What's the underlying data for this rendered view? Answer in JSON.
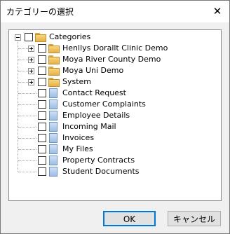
{
  "dialog": {
    "title": "カテゴリーの選択",
    "close_label": "✕"
  },
  "tree": {
    "root": {
      "label": "Categories",
      "expanded": true,
      "checked": false
    },
    "groups": [
      {
        "label": "Henllys Dorallt Clinic Demo",
        "expanded": false,
        "checked": false
      },
      {
        "label": "Moya River County Demo",
        "expanded": false,
        "checked": false
      },
      {
        "label": "Moya Uni Demo",
        "expanded": false,
        "checked": false
      },
      {
        "label": "System",
        "expanded": false,
        "checked": false
      }
    ],
    "items": [
      {
        "label": "Contact Request",
        "checked": false
      },
      {
        "label": "Customer Complaints",
        "checked": false
      },
      {
        "label": "Employee Details",
        "checked": false
      },
      {
        "label": "Incoming Mail",
        "checked": false
      },
      {
        "label": "Invoices",
        "checked": false
      },
      {
        "label": "My Files",
        "checked": false
      },
      {
        "label": "Property Contracts",
        "checked": false
      },
      {
        "label": "Student Documents",
        "checked": false
      }
    ]
  },
  "buttons": {
    "ok": "OK",
    "cancel": "キャンセル"
  }
}
